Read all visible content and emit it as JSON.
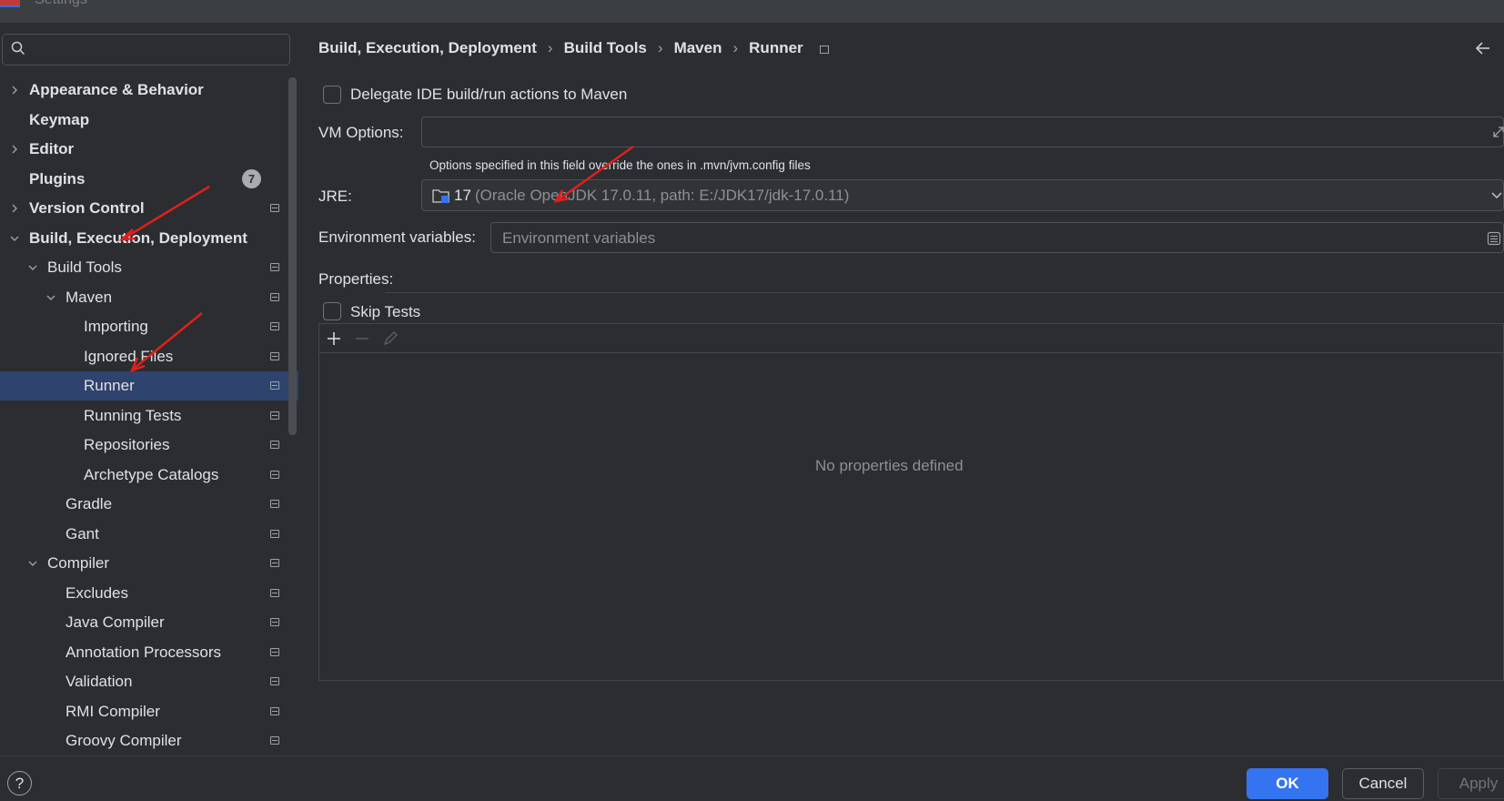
{
  "window": {
    "title": "Settings"
  },
  "search": {
    "placeholder": ""
  },
  "sidebar": {
    "items": [
      {
        "label": "Appearance & Behavior",
        "bold": true,
        "chevron": "right",
        "indent": 0
      },
      {
        "label": "Keymap",
        "bold": true,
        "chevron": "none",
        "indent": 0
      },
      {
        "label": "Editor",
        "bold": true,
        "chevron": "right",
        "indent": 0
      },
      {
        "label": "Plugins",
        "bold": true,
        "chevron": "none",
        "indent": 0,
        "badge": "7"
      },
      {
        "label": "Version Control",
        "bold": true,
        "chevron": "right",
        "indent": 0,
        "proj": true
      },
      {
        "label": "Build, Execution, Deployment",
        "bold": true,
        "chevron": "down",
        "indent": 0
      },
      {
        "label": "Build Tools",
        "bold": false,
        "chevron": "down",
        "indent": 1,
        "proj": true
      },
      {
        "label": "Maven",
        "bold": false,
        "chevron": "down",
        "indent": 2,
        "proj": true
      },
      {
        "label": "Importing",
        "bold": false,
        "chevron": "none",
        "indent": 3,
        "proj": true
      },
      {
        "label": "Ignored Files",
        "bold": false,
        "chevron": "none",
        "indent": 3,
        "proj": true
      },
      {
        "label": "Runner",
        "bold": false,
        "chevron": "none",
        "indent": 3,
        "proj": true,
        "selected": true
      },
      {
        "label": "Running Tests",
        "bold": false,
        "chevron": "none",
        "indent": 3,
        "proj": true
      },
      {
        "label": "Repositories",
        "bold": false,
        "chevron": "none",
        "indent": 3,
        "proj": true
      },
      {
        "label": "Archetype Catalogs",
        "bold": false,
        "chevron": "none",
        "indent": 3,
        "proj": true
      },
      {
        "label": "Gradle",
        "bold": false,
        "chevron": "none",
        "indent": 2,
        "proj": true
      },
      {
        "label": "Gant",
        "bold": false,
        "chevron": "none",
        "indent": 2,
        "proj": true
      },
      {
        "label": "Compiler",
        "bold": false,
        "chevron": "down",
        "indent": 1,
        "proj": true
      },
      {
        "label": "Excludes",
        "bold": false,
        "chevron": "none",
        "indent": 2,
        "proj": true
      },
      {
        "label": "Java Compiler",
        "bold": false,
        "chevron": "none",
        "indent": 2,
        "proj": true
      },
      {
        "label": "Annotation Processors",
        "bold": false,
        "chevron": "none",
        "indent": 2,
        "proj": true
      },
      {
        "label": "Validation",
        "bold": false,
        "chevron": "none",
        "indent": 2,
        "proj": true
      },
      {
        "label": "RMI Compiler",
        "bold": false,
        "chevron": "none",
        "indent": 2,
        "proj": true
      },
      {
        "label": "Groovy Compiler",
        "bold": false,
        "chevron": "none",
        "indent": 2,
        "proj": true
      }
    ]
  },
  "breadcrumb": [
    "Build, Execution, Deployment",
    "Build Tools",
    "Maven",
    "Runner"
  ],
  "main": {
    "delegate_label": "Delegate IDE build/run actions to Maven",
    "delegate_checked": false,
    "vm_options_label": "VM Options:",
    "vm_options_value": "",
    "vm_options_hint": "Options specified in this field override the ones in .mvn/jvm.config files",
    "jre_label": "JRE:",
    "jre_version": "17",
    "jre_detail": "(Oracle OpenJDK 17.0.11, path: E:/JDK17/jdk-17.0.11)",
    "env_label": "Environment variables:",
    "env_placeholder": "Environment variables",
    "properties_label": "Properties:",
    "skip_tests_label": "Skip Tests",
    "skip_tests_checked": false,
    "empty_table_text": "No properties defined"
  },
  "footer": {
    "help_label": "?",
    "ok_label": "OK",
    "cancel_label": "Cancel",
    "apply_label": "Apply"
  },
  "colors": {
    "background": "#2b2d30",
    "selection": "#2e436e",
    "accent": "#3574f0",
    "annotation_arrow": "#e0201c"
  }
}
